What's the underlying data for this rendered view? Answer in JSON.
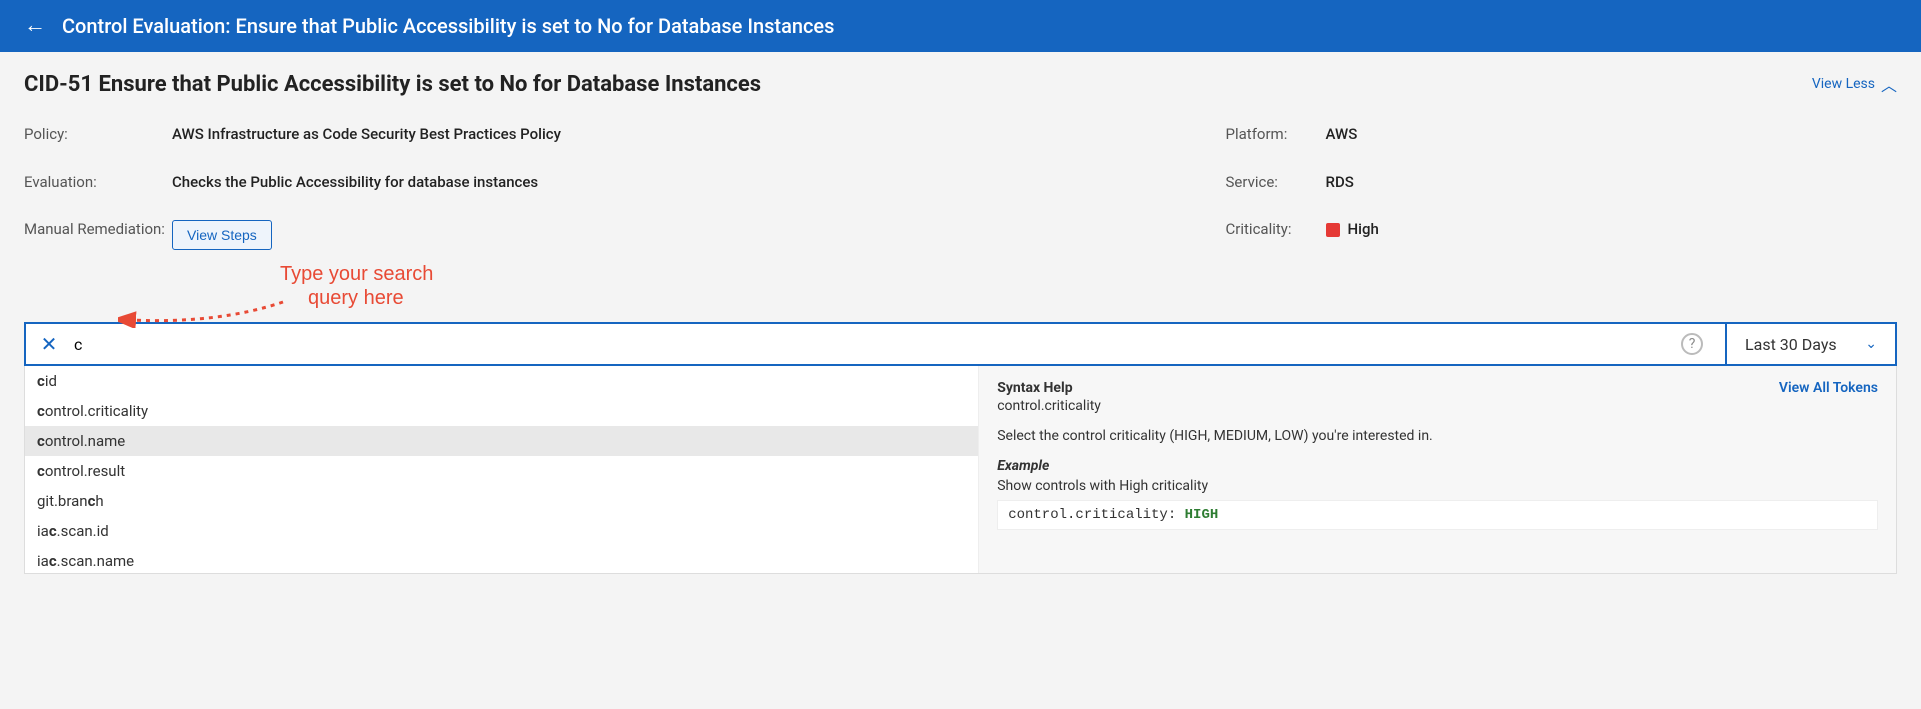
{
  "header": {
    "title": "Control Evaluation: Ensure that Public Accessibility is set to No for Database Instances"
  },
  "page": {
    "title": "CID-51 Ensure that Public Accessibility is set to No for Database Instances",
    "view_less": "View Less"
  },
  "details": {
    "policy_label": "Policy:",
    "policy_value": "AWS Infrastructure as Code Security Best Practices Policy",
    "evaluation_label": "Evaluation:",
    "evaluation_value": "Checks the Public Accessibility for database instances",
    "manual_label": "Manual Remediation:",
    "view_steps": "View Steps",
    "platform_label": "Platform:",
    "platform_value": "AWS",
    "service_label": "Service:",
    "service_value": "RDS",
    "criticality_label": "Criticality:",
    "criticality_value": "High",
    "criticality_color": "#e53935"
  },
  "annotation": {
    "line1": "Type your search",
    "line2": "query here"
  },
  "search": {
    "query": "c",
    "range": "Last 30 Days"
  },
  "suggestions": [
    {
      "pre": "",
      "match": "c",
      "post": "id"
    },
    {
      "pre": "",
      "match": "c",
      "post": "ontrol.criticality"
    },
    {
      "pre": "",
      "match": "c",
      "post": "ontrol.name"
    },
    {
      "pre": "",
      "match": "c",
      "post": "ontrol.result"
    },
    {
      "pre": "git.bran",
      "match": "c",
      "post": "h"
    },
    {
      "pre": "ia",
      "match": "c",
      "post": ".scan.id"
    },
    {
      "pre": "ia",
      "match": "c",
      "post": ".scan.name"
    }
  ],
  "syntax": {
    "title": "Syntax Help",
    "view_all": "View All Tokens",
    "token": "control.criticality",
    "description": "Select the control criticality (HIGH, MEDIUM, LOW) you're interested in.",
    "example_label": "Example",
    "example_desc": "Show controls with High criticality",
    "code_key": "control.criticality: ",
    "code_val": "HIGH"
  }
}
